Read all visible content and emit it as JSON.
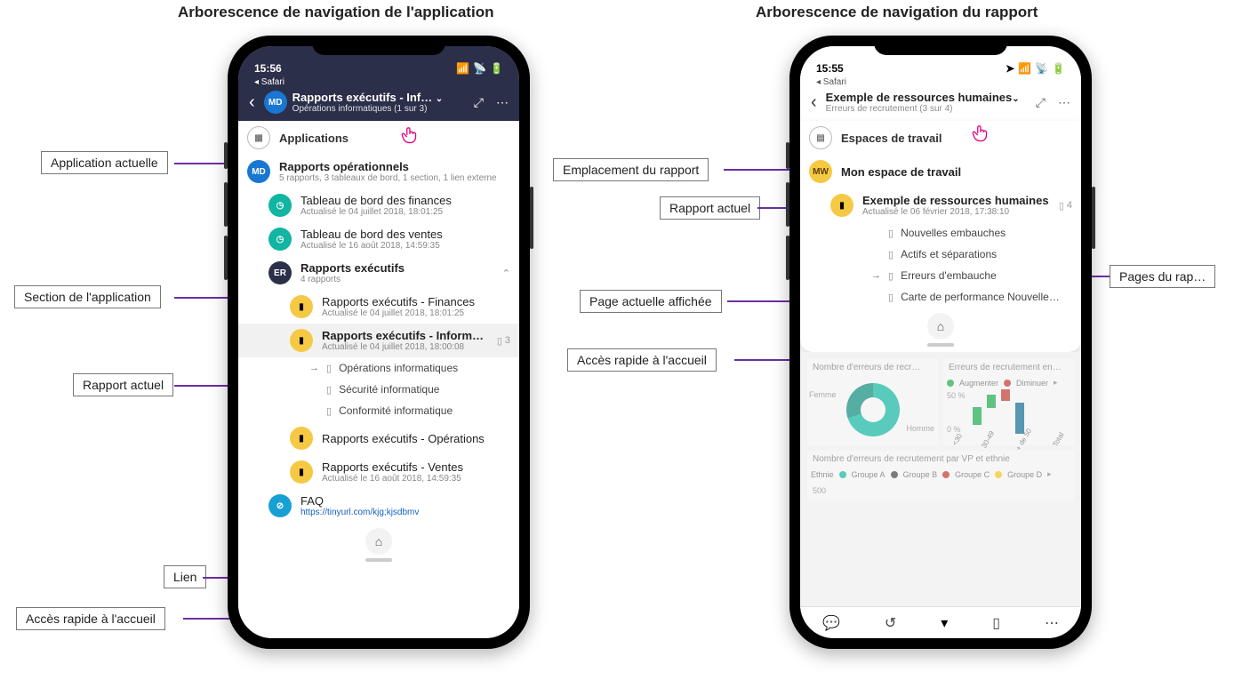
{
  "titles": {
    "left": "Arborescence de navigation de l'application",
    "right": "Arborescence de navigation du rapport"
  },
  "callouts": {
    "app_current": "Application actuelle",
    "app_section": "Section de l'application",
    "report_current_left": "Rapport actuel",
    "link": "Lien",
    "home_quick_left": "Accès rapide à l'accueil",
    "report_location": "Emplacement du rapport",
    "report_current_right": "Rapport actuel",
    "page_current": "Page actuelle affichée",
    "home_quick_right": "Accès rapide à l'accueil",
    "report_pages": "Pages du rap…"
  },
  "left_phone": {
    "status": {
      "time": "15:56",
      "back": "◂ Safari"
    },
    "header": {
      "title": "Rapports exécutifs - Inf…",
      "subtitle": "Opérations informatiques (1 sur 3)",
      "avatar_text": "MD"
    },
    "applications_label": "Applications",
    "app": {
      "avatar_text": "MD",
      "title": "Rapports opérationnels",
      "subtitle": "5 rapports, 3 tableaux de bord, 1 section, 1 lien externe"
    },
    "dashboards": [
      {
        "title": "Tableau de bord des finances",
        "subtitle": "Actualisé le 04 juillet 2018, 18:01:25"
      },
      {
        "title": "Tableau de bord des ventes",
        "subtitle": "Actualisé le 16 août 2018, 14:59:35"
      }
    ],
    "section": {
      "avatar_text": "ER",
      "title": "Rapports exécutifs",
      "subtitle": "4 rapports"
    },
    "reports": [
      {
        "title": "Rapports exécutifs - Finances",
        "subtitle": "Actualisé le 04 juillet 2018, 18:01:25"
      },
      {
        "title": "Rapports exécutifs - Inform…",
        "subtitle": "Actualisé le 04 juillet 2018, 18:00:08",
        "count": "3",
        "selected": true,
        "pages": [
          {
            "label": "Opérations informatiques",
            "current": true
          },
          {
            "label": "Sécurité informatique"
          },
          {
            "label": "Conformité informatique"
          }
        ]
      },
      {
        "title": "Rapports exécutifs - Opérations"
      },
      {
        "title": "Rapports exécutifs - Ventes",
        "subtitle": "Actualisé le 16 août 2018, 14:59:35"
      }
    ],
    "link": {
      "title": "FAQ",
      "url": "https://tinyurl.com/kjg;kjsdbmv"
    }
  },
  "right_phone": {
    "status": {
      "time": "15:55",
      "back": "◂ Safari"
    },
    "header": {
      "title": "Exemple de ressources humaines",
      "subtitle": "Erreurs de recrutement (3 sur 4)"
    },
    "workspaces_label": "Espaces de travail",
    "workspace": {
      "avatar_text": "MW",
      "title": "Mon espace de travail"
    },
    "report": {
      "title": "Exemple de ressources humaines",
      "subtitle": "Actualisé le 06 février 2018, 17:38:10",
      "count": "4",
      "pages": [
        {
          "label": "Nouvelles embauches"
        },
        {
          "label": "Actifs et séparations"
        },
        {
          "label": "Erreurs d'embauche",
          "current": true
        },
        {
          "label": "Carte de performance Nouvelle…"
        }
      ]
    },
    "report_bg": {
      "tile1": "Nombre d'erreurs de recr…",
      "tile2": "Erreurs de recrutement en…",
      "legend_aug": "Augmenter",
      "legend_dim": "Diminuer",
      "femme": "Femme",
      "homme": "Homme",
      "pct": "50 %",
      "pct0": "0 %",
      "xlabels": [
        "<30",
        "30-49",
        "+ de 50",
        "Total"
      ],
      "tile3": "Nombre d'erreurs de recrutement par VP et ethnie",
      "ethnie": "Ethnie",
      "groups": [
        "Groupe A",
        "Groupe B",
        "Groupe C",
        "Groupe D"
      ],
      "y500": "500"
    }
  },
  "icons": {
    "signal": "▮▮▮▮",
    "wifi": "⦿",
    "battery": "▭"
  }
}
